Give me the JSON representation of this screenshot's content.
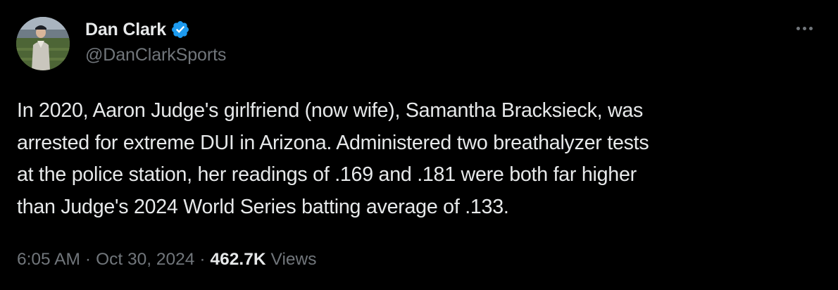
{
  "author": {
    "display_name": "Dan Clark",
    "handle": "@DanClarkSports",
    "verified": true
  },
  "tweet": {
    "lines": [
      "In 2020, Aaron Judge's girlfriend (now wife), Samantha Bracksieck, was",
      "arrested for extreme DUI in Arizona. Administered two breathalyzer tests",
      "at the police station, her readings of .169 and .181 were both far higher",
      "than Judge's 2024 World Series batting average of .133."
    ],
    "time": "6:05 AM",
    "separator": "·",
    "date": "Oct 30, 2024",
    "views_count": "462.7K",
    "views_label": "Views"
  },
  "icons": {
    "more": "more-horizontal-icon",
    "verified": "verified-badge-icon"
  },
  "colors": {
    "background": "#000000",
    "text_primary": "#e7e9ea",
    "text_secondary": "#71767b",
    "verified_blue": "#1d9bf0"
  }
}
